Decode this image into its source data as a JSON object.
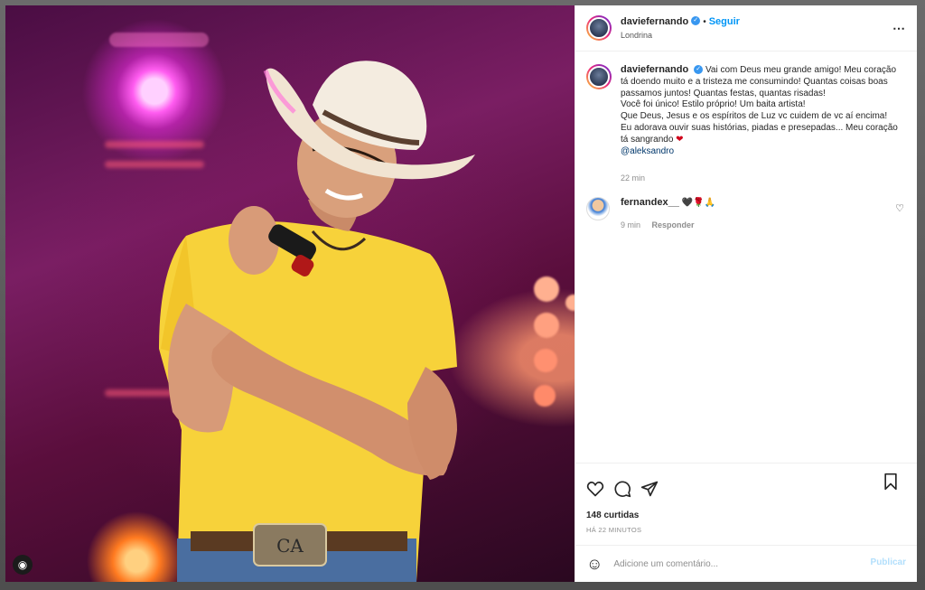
{
  "post": {
    "username": "daviefernando",
    "verified_mark": "✓",
    "separator": "•",
    "follow_label": "Seguir",
    "location": "Londrina",
    "more_icon": "⋯",
    "caption_lines": [
      "Vai com Deus meu grande amigo! Meu coração tá doendo muito e a tristeza me consumindo! Quantas coisas boas passamos juntos! Quantas festas, quantas risadas!",
      "Você foi único! Estilo próprio! Um baita artista!",
      "Que Deus, Jesus e os espíritos de Luz vc cuidem de vc aí encima!",
      "Eu adorava ouvir suas histórias, piadas e presepadas... Meu coração tá sangrando"
    ],
    "caption_heart": "❤",
    "mention": "@aleksandro",
    "caption_time": "22 min"
  },
  "comment": {
    "username": "fernandex__",
    "text": "🖤🌹🙏",
    "time": "9 min",
    "reply_label": "Responder",
    "like_icon": "♡"
  },
  "actions": {
    "likes_text": "148 curtidas",
    "posted_ago": "HÁ 22 MINUTOS"
  },
  "add_comment": {
    "emoji_icon": "☺",
    "placeholder": "Adicione um comentário...",
    "publish_label": "Publicar"
  },
  "photo": {
    "ig_badge_icon": "◉"
  },
  "colors": {
    "accent": "#0095f6",
    "text": "#262626",
    "muted": "#8e8e8e",
    "heart": "#d0021b"
  }
}
